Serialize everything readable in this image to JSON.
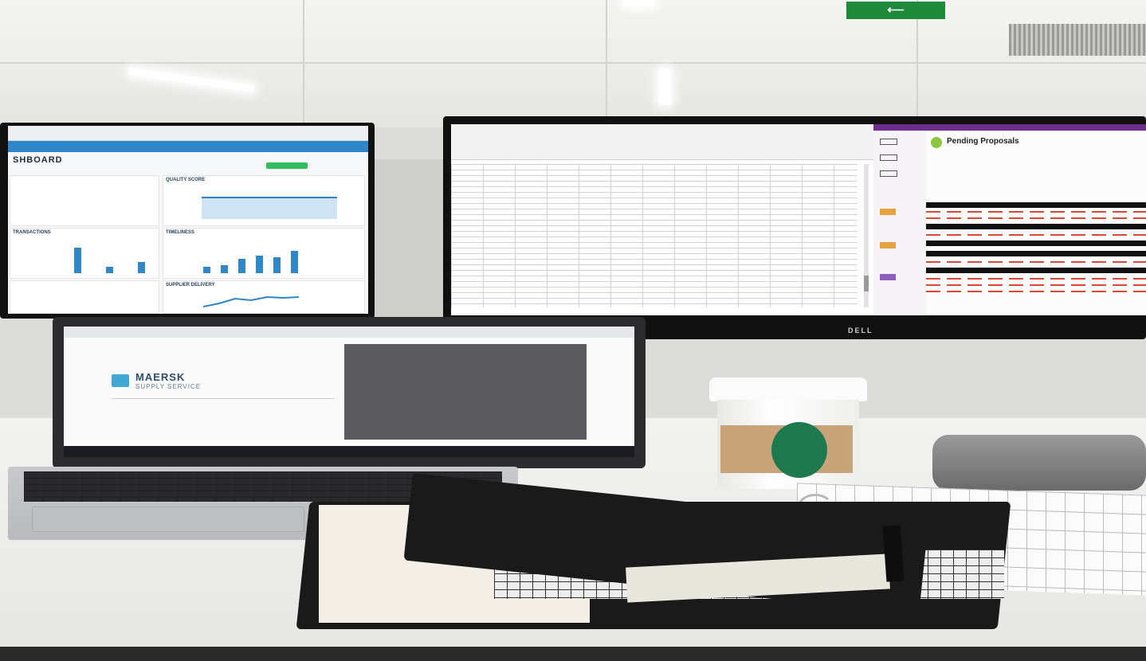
{
  "exit_sign": {
    "arrow": "⟵"
  },
  "left_monitor": {
    "title": "SHBOARD",
    "panels": [
      {
        "title": "QUALITY SCORE",
        "subtitle": "..."
      },
      {
        "title": "TRANSACTIONS"
      },
      {
        "title": "TIMELINESS"
      },
      {
        "title": "SUPPLIER DELIVERY"
      }
    ],
    "bars_left": [
      0.8,
      0.2,
      0.35
    ],
    "bars_right": [
      0.2,
      0.25,
      0.45,
      0.55,
      0.5,
      0.7
    ]
  },
  "right_monitor": {
    "panel_title": "Pending Proposals",
    "brand": "DELL"
  },
  "laptop": {
    "logo_text": "MAERSK",
    "logo_sub": "SUPPLY SERVICE"
  },
  "colors": {
    "exit_green": "#1c8a3a",
    "dashboard_blue": "#2f86c9",
    "sidebar_purple": "#6a2f8d",
    "starbucks_green": "#1e7a4e"
  }
}
